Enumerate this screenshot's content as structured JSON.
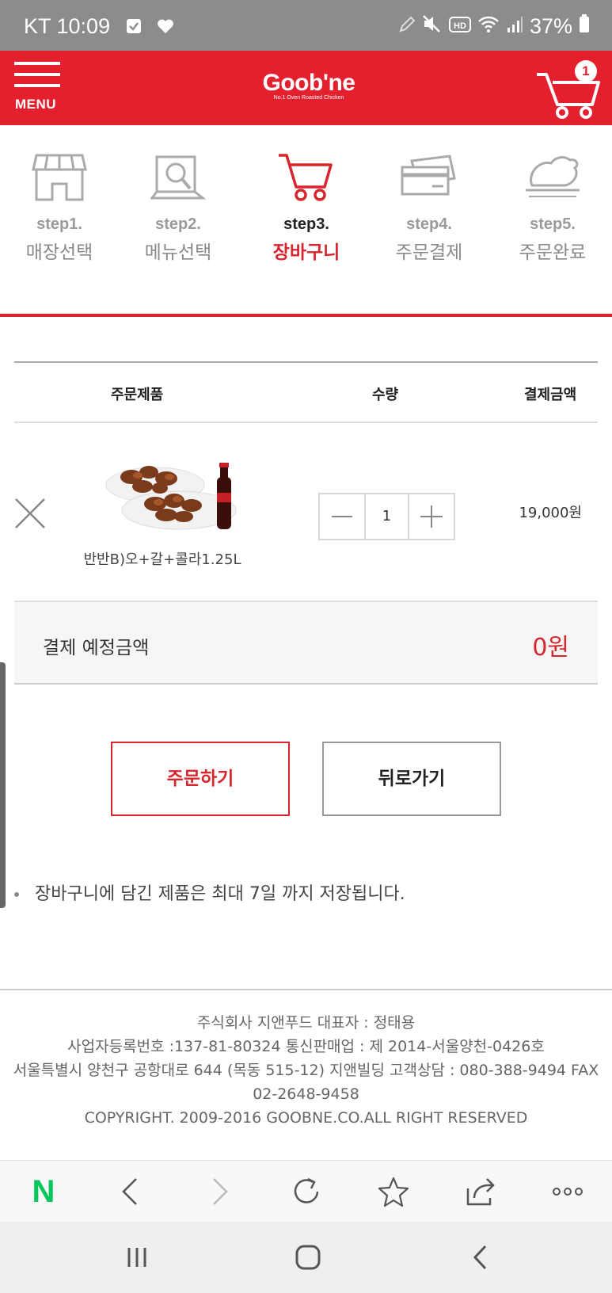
{
  "status_bar": {
    "carrier_time": "KT 10:09",
    "battery": "37%"
  },
  "header": {
    "menu_label": "MENU",
    "logo_text": "Goob'ne",
    "logo_tagline": "No.1 Oven Roasted Chicken",
    "cart_count": "1",
    "brand_color": "#e4202e"
  },
  "steps": [
    {
      "num": "step1.",
      "name": "매장선택",
      "icon": "store-icon"
    },
    {
      "num": "step2.",
      "name": "메뉴선택",
      "icon": "menu-search-icon"
    },
    {
      "num": "step3.",
      "name": "장바구니",
      "icon": "cart-icon",
      "active": true
    },
    {
      "num": "step4.",
      "name": "주문결제",
      "icon": "card-icon"
    },
    {
      "num": "step5.",
      "name": "주문완료",
      "icon": "chicken-icon"
    }
  ],
  "table": {
    "col_product": "주문제품",
    "col_qty": "수량",
    "col_amount": "결제금액"
  },
  "item": {
    "name": "반반B)오+갈+콜라1.25L",
    "qty": "1",
    "price": "19,000원"
  },
  "total": {
    "label": "결제 예정금액",
    "value": "0원"
  },
  "buttons": {
    "order": "주문하기",
    "back": "뒤로가기"
  },
  "notice": "장바구니에 담긴 제품은 최대 7일 까지 저장됩니다.",
  "footer": {
    "line1": "주식회사 지앤푸드 대표자 : 정태용",
    "line2": "사업자등록번호 :137-81-80324 통신판매업 : 제 2014-서울양천-0426호",
    "line3": "서울특별시 양천구 공항대로 644 (목동 515-12) 지앤빌딩 고객상담 : 080-388-9494 FAX",
    "line4": "02-2648-9458",
    "line5": "COPYRIGHT. 2009-2016 GOOBNE.CO.ALL RIGHT RESERVED"
  },
  "browser_bar": {
    "naver_label": "N"
  }
}
